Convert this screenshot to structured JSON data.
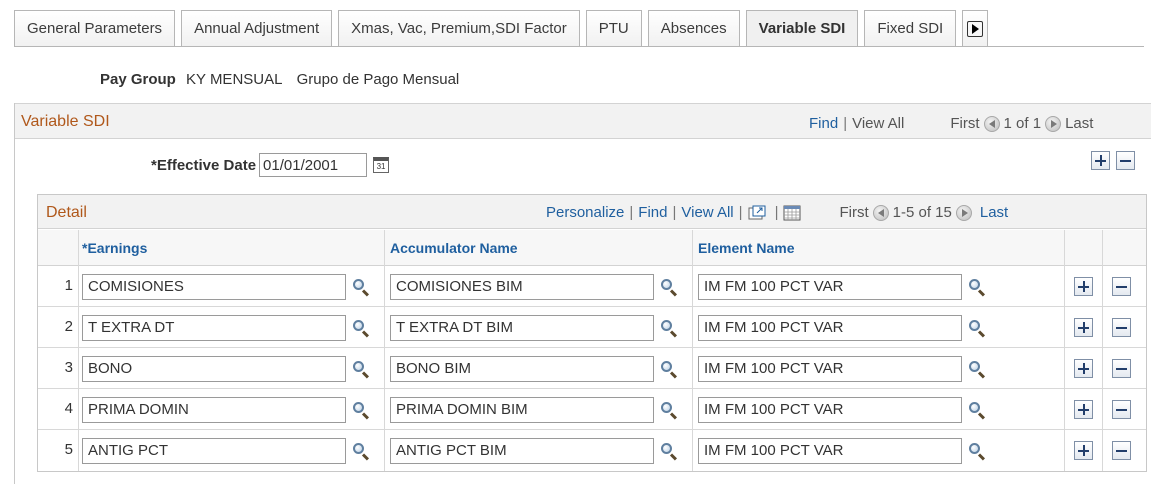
{
  "tabs": [
    {
      "label": "General Parameters",
      "active": false
    },
    {
      "label": "Annual Adjustment",
      "active": false
    },
    {
      "label": "Xmas, Vac, Premium,SDI Factor",
      "active": false
    },
    {
      "label": "PTU",
      "active": false
    },
    {
      "label": "Absences",
      "active": false
    },
    {
      "label": "Variable SDI",
      "active": true
    },
    {
      "label": "Fixed SDI",
      "active": false
    }
  ],
  "pay_group": {
    "label": "Pay Group",
    "code": "KY MENSUAL",
    "description": "Grupo de Pago Mensual"
  },
  "variable_sdi": {
    "title": "Variable SDI",
    "find": "Find",
    "sep": "|",
    "view_all": "View All",
    "first": "First",
    "count": "1 of 1",
    "last": "Last",
    "effective_date_label": "*Effective Date",
    "effective_date": "01/01/2001",
    "calendar_glyph": "31"
  },
  "detail": {
    "title": "Detail",
    "personalize": "Personalize",
    "find": "Find",
    "view_all": "View All",
    "sep": "|",
    "first": "First",
    "count": "1-5 of 15",
    "last": "Last",
    "columns": {
      "earnings": "*Earnings",
      "accumulator": "Accumulator Name",
      "element": "Element Name"
    },
    "rows": [
      {
        "num": "1",
        "earnings": "COMISIONES",
        "accumulator": "COMISIONES BIM",
        "element": "IM FM 100 PCT VAR"
      },
      {
        "num": "2",
        "earnings": "T EXTRA DT",
        "accumulator": "T EXTRA DT BIM",
        "element": "IM FM 100 PCT VAR"
      },
      {
        "num": "3",
        "earnings": "BONO",
        "accumulator": "BONO BIM",
        "element": "IM FM 100 PCT VAR"
      },
      {
        "num": "4",
        "earnings": "PRIMA DOMIN",
        "accumulator": "PRIMA DOMIN BIM",
        "element": "IM FM 100 PCT VAR"
      },
      {
        "num": "5",
        "earnings": "ANTIG PCT",
        "accumulator": "ANTIG PCT BIM",
        "element": "IM FM 100 PCT VAR"
      }
    ]
  }
}
